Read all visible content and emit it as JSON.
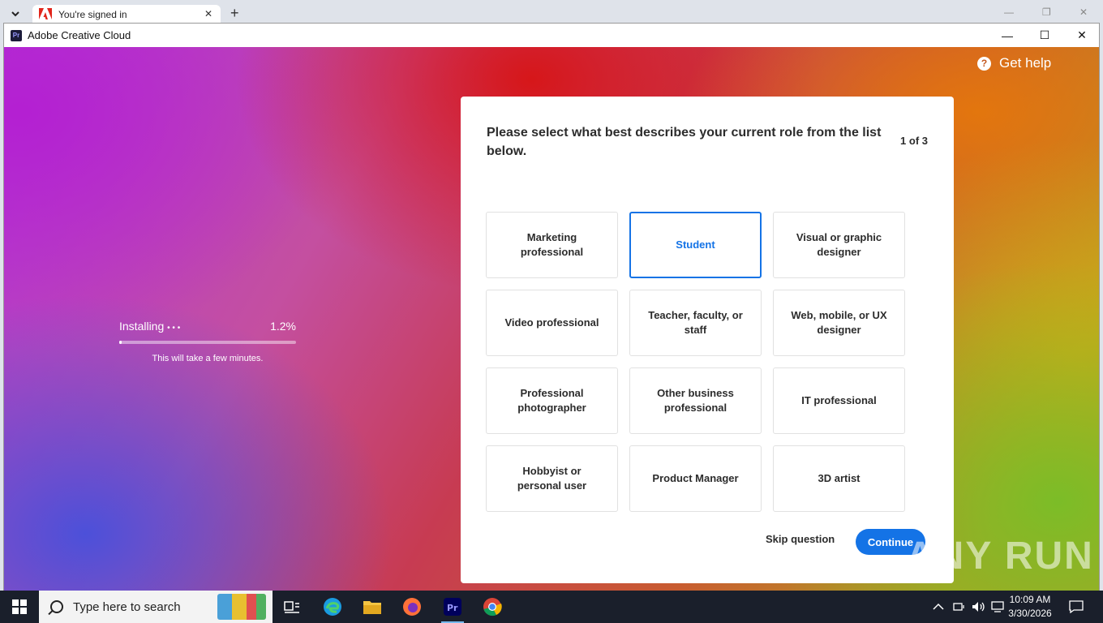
{
  "browser": {
    "tab_title": "You're signed in",
    "new_tab_symbol": "+",
    "tab_close_symbol": "✕"
  },
  "window": {
    "title": "Adobe Creative Cloud",
    "app_icon_text": "Pr",
    "minimize": "—",
    "maximize": "☐",
    "close": "✕"
  },
  "header": {
    "get_help": "Get help",
    "help_icon_glyph": "?"
  },
  "install": {
    "label": "Installing",
    "progress_text": "1.2%",
    "progress_fraction": 0.012,
    "note": "This will take a few minutes."
  },
  "survey": {
    "question": "Please select what best describes your current role from the list below.",
    "step": "1 of 3",
    "selected_index": 1,
    "options": [
      "Marketing professional",
      "Student",
      "Visual or graphic designer",
      "Video professional",
      "Teacher, faculty, or staff",
      "Web, mobile, or UX designer",
      "Professional photographer",
      "Other business professional",
      "IT professional",
      "Hobbyist or personal user",
      "Product Manager",
      "3D artist"
    ],
    "skip_label": "Skip question",
    "continue_label": "Continue"
  },
  "watermark": "ANY RUN",
  "taskbar": {
    "search_placeholder": "Type here to search",
    "time": "10:09 AM",
    "date": "3/30/2026",
    "icons": [
      "task-view-icon",
      "edge-icon",
      "file-explorer-icon",
      "firefox-icon",
      "premiere-icon",
      "chrome-icon"
    ]
  },
  "colors": {
    "accent": "#1473e6",
    "taskbar": "#1a1f2b"
  }
}
